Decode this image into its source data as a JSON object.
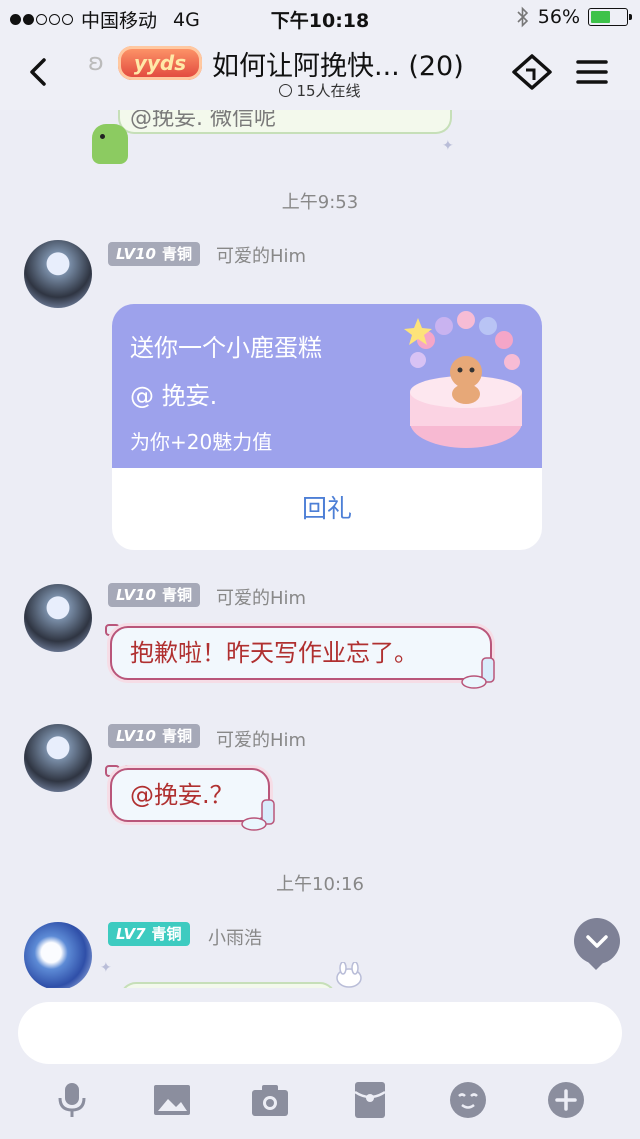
{
  "status_bar": {
    "carrier": "中国移动",
    "network": "4G",
    "time": "下午10:18",
    "battery_percent": "56%",
    "battery_level": 0.56
  },
  "header": {
    "back_icon": "chevron-left-icon",
    "badge_text": "yyds",
    "title": "如何让阿挽快...",
    "member_count": "(20)",
    "online_text": "15人在线",
    "right_icons": [
      "ticket-icon",
      "menu-icon"
    ]
  },
  "chat": {
    "previous_message_partial": "@挽妄. 微信呢",
    "messages": [
      {
        "type": "timestamp",
        "text": "上午9:53"
      },
      {
        "type": "gift",
        "level": "LV10",
        "rank": "青铜",
        "nickname": "可爱的Him",
        "line1": "送你一个小鹿蛋糕",
        "line2": "@ 挽妄.",
        "line3": "为你+20魅力值",
        "action": "回礼"
      },
      {
        "type": "text",
        "level": "LV10",
        "rank": "青铜",
        "nickname": "可爱的Him",
        "text": "抱歉啦！昨天写作业忘了。"
      },
      {
        "type": "text",
        "level": "LV10",
        "rank": "青铜",
        "nickname": "可爱的Him",
        "text": "@挽妄.？"
      },
      {
        "type": "timestamp",
        "text": "上午10:16"
      },
      {
        "type": "text",
        "level": "LV7",
        "rank": "青铜",
        "nickname": "小雨浩",
        "text": ""
      }
    ]
  },
  "input": {
    "placeholder": ""
  },
  "toolbar": [
    "microphone-icon",
    "image-icon",
    "camera-icon",
    "red-packet-icon",
    "emoji-icon",
    "plus-icon"
  ],
  "colors": {
    "background": "#ecedf5",
    "gift_card": "#9da2ec",
    "reply_link": "#4d7fd6",
    "bubble_text": "#b03030",
    "level_badge_gray": "#a6a9b8",
    "level_badge_teal": "#3dcbc0",
    "battery_green": "#3ec24a"
  }
}
